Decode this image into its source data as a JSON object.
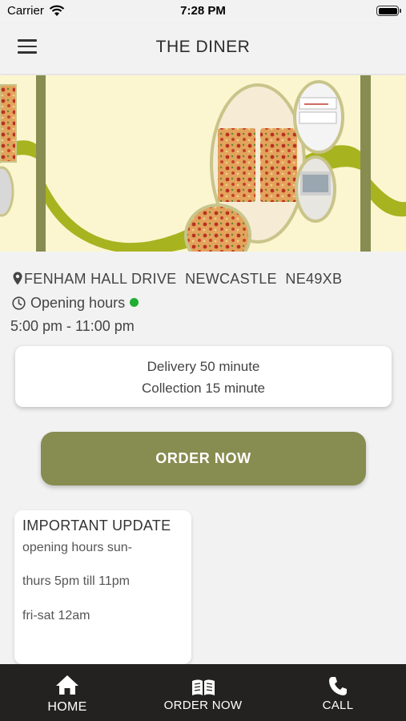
{
  "status_bar": {
    "carrier": "Carrier",
    "time": "7:28 PM",
    "icons": [
      "wifi-icon",
      "battery-icon"
    ]
  },
  "header": {
    "title": "THE DINER",
    "menu_icon": "hamburger-menu-icon"
  },
  "hero": {
    "description_icon": "banner-image"
  },
  "location": {
    "street": "FENHAM HALL DRIVE",
    "city": "NEWCASTLE",
    "postcode": "NE49XB",
    "icon": "map-pin-icon"
  },
  "opening": {
    "label": "Opening hours",
    "status_color": "#1fae32",
    "times": "5:00 pm - 11:00 pm",
    "icon": "clock-icon"
  },
  "service_times": {
    "delivery": "Delivery 50 minute",
    "collection": "Collection 15 minute"
  },
  "order_button": {
    "label": "ORDER NOW",
    "color": "#878c50"
  },
  "update": {
    "title": "IMPORTANT UPDATE",
    "lines": [
      "opening hours sun-",
      "thurs 5pm till 11pm",
      "fri-sat 12am"
    ]
  },
  "tab_bar": {
    "tabs": [
      {
        "label": "HOME",
        "icon": "home-icon"
      },
      {
        "label": "ORDER NOW",
        "icon": "open-book-icon"
      },
      {
        "label": "CALL",
        "icon": "phone-icon"
      }
    ]
  },
  "colors": {
    "accent": "#878c50",
    "hero_bg": "#fbf6cf",
    "hero_wave": "#a8b320",
    "tab_bar": "#232220"
  }
}
